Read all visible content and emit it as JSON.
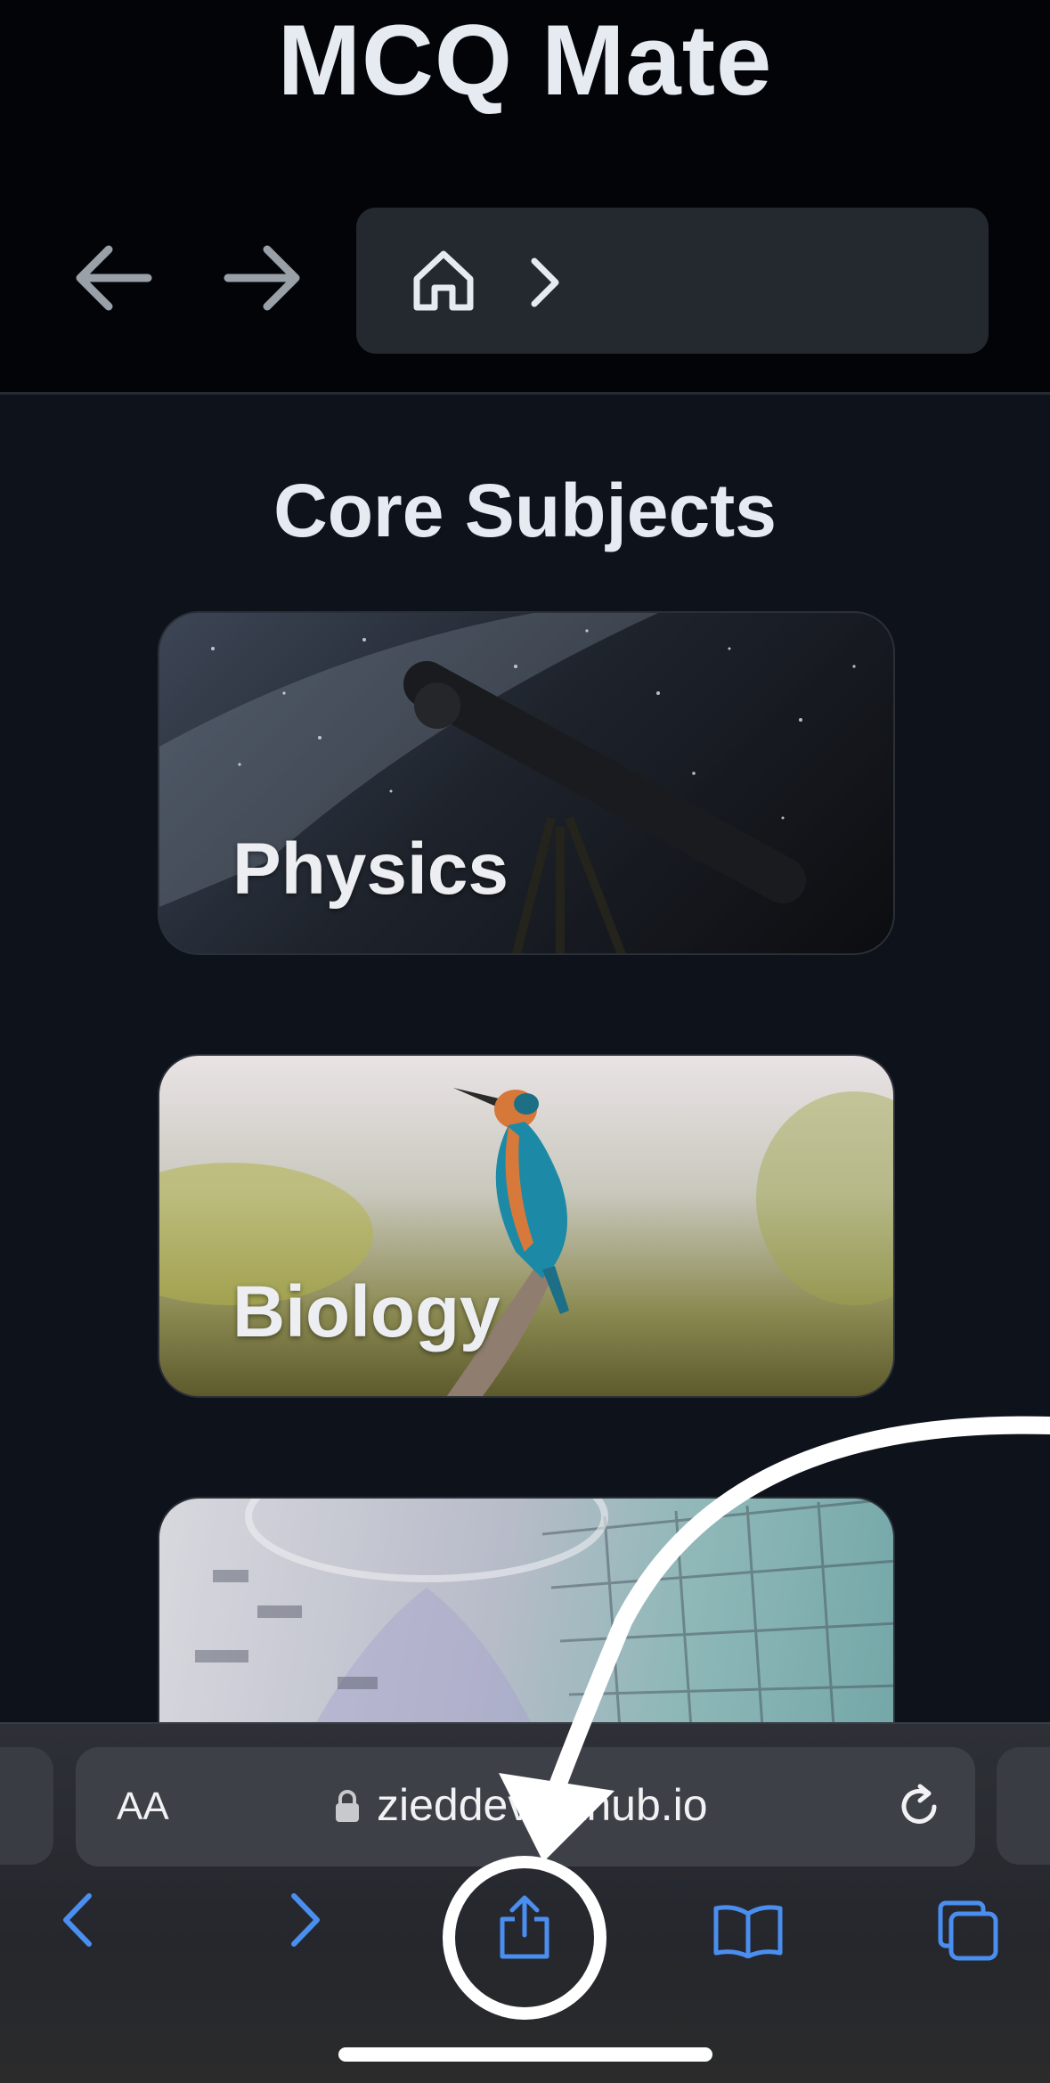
{
  "header": {
    "title": "MCQ Mate"
  },
  "icons": {
    "back": "arrow-left-icon",
    "forward": "arrow-right-icon",
    "home": "home-icon",
    "breadcrumb_separator": "chevron-right-icon"
  },
  "main": {
    "section_title": "Core Subjects",
    "subjects": [
      {
        "label": "Physics"
      },
      {
        "label": "Biology"
      },
      {
        "label": ""
      }
    ]
  },
  "safari": {
    "text_size_label": "AA",
    "url": "zieddev.github.io",
    "toolbar_icons": [
      "back-icon",
      "forward-icon",
      "share-icon",
      "bookmarks-icon",
      "tabs-icon"
    ]
  },
  "colors": {
    "background": "#0d121b",
    "header_bg": "#030408",
    "accent_blue": "#4a8ef0",
    "text_light": "#e6ebf2"
  }
}
